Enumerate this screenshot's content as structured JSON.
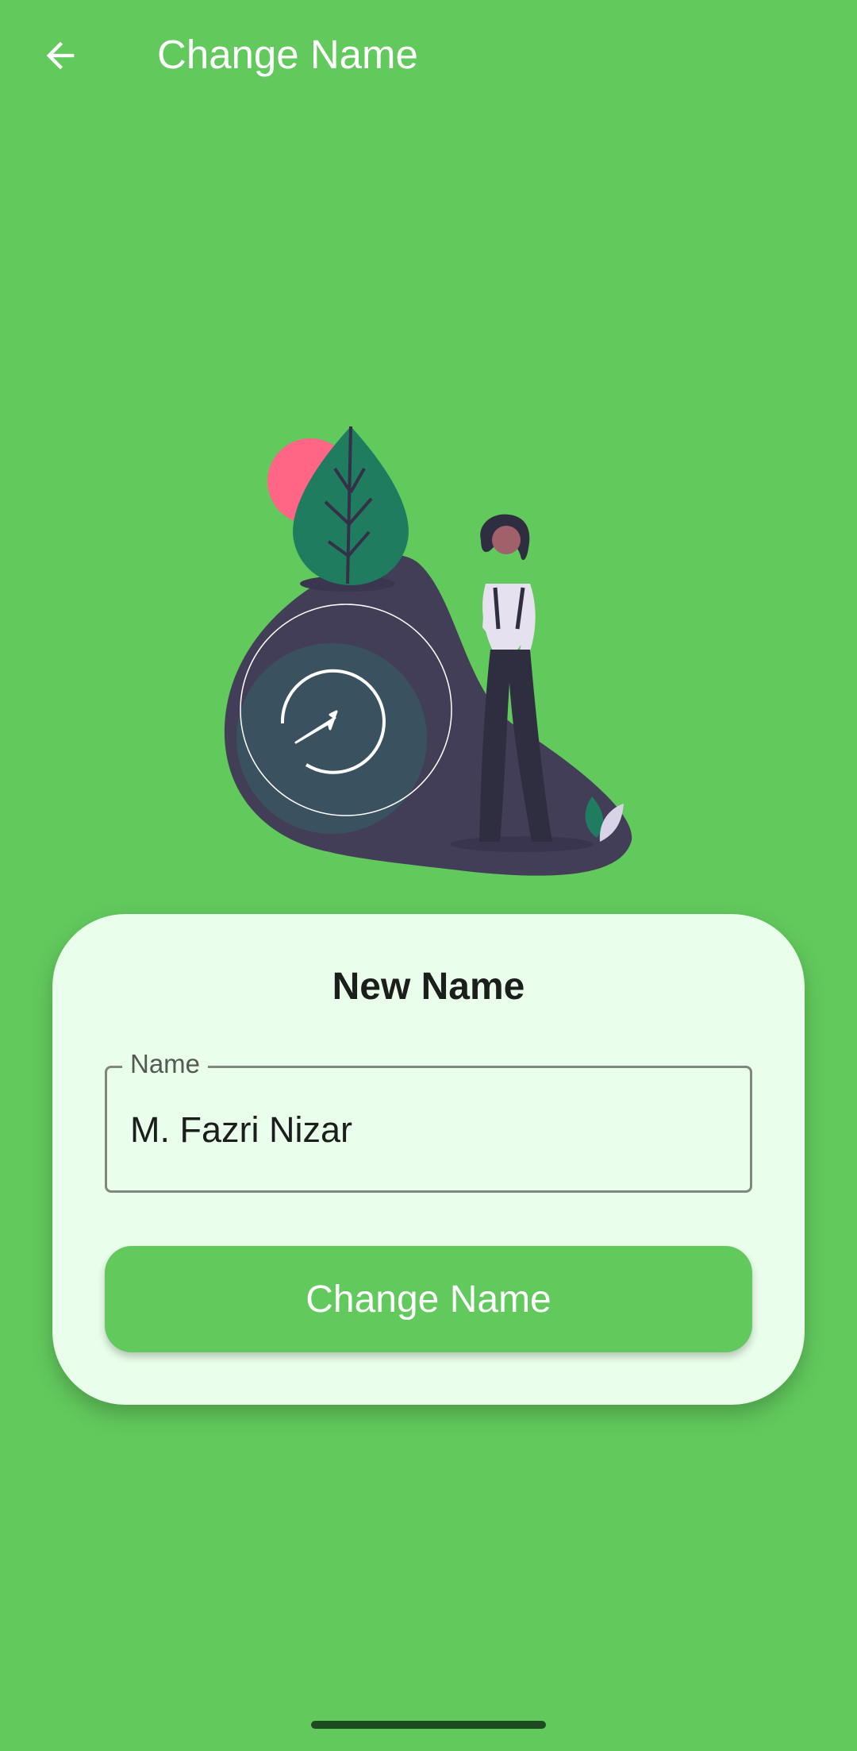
{
  "app_bar": {
    "title": "Change Name",
    "back_icon": "arrow-left-icon"
  },
  "illustration": {
    "name": "personal-settings-illustration",
    "colors": {
      "leaf": "#1f7c5e",
      "sun": "#ff6584",
      "blob": "#3f3d56",
      "ring": "#3a5260"
    }
  },
  "card": {
    "title": "New Name",
    "name_field": {
      "label": "Name",
      "value": "M. Fazri Nizar"
    },
    "button_label": "Change Name"
  },
  "colors": {
    "background": "#62c95d",
    "card": "#eaffeb",
    "button": "#62c95d"
  }
}
